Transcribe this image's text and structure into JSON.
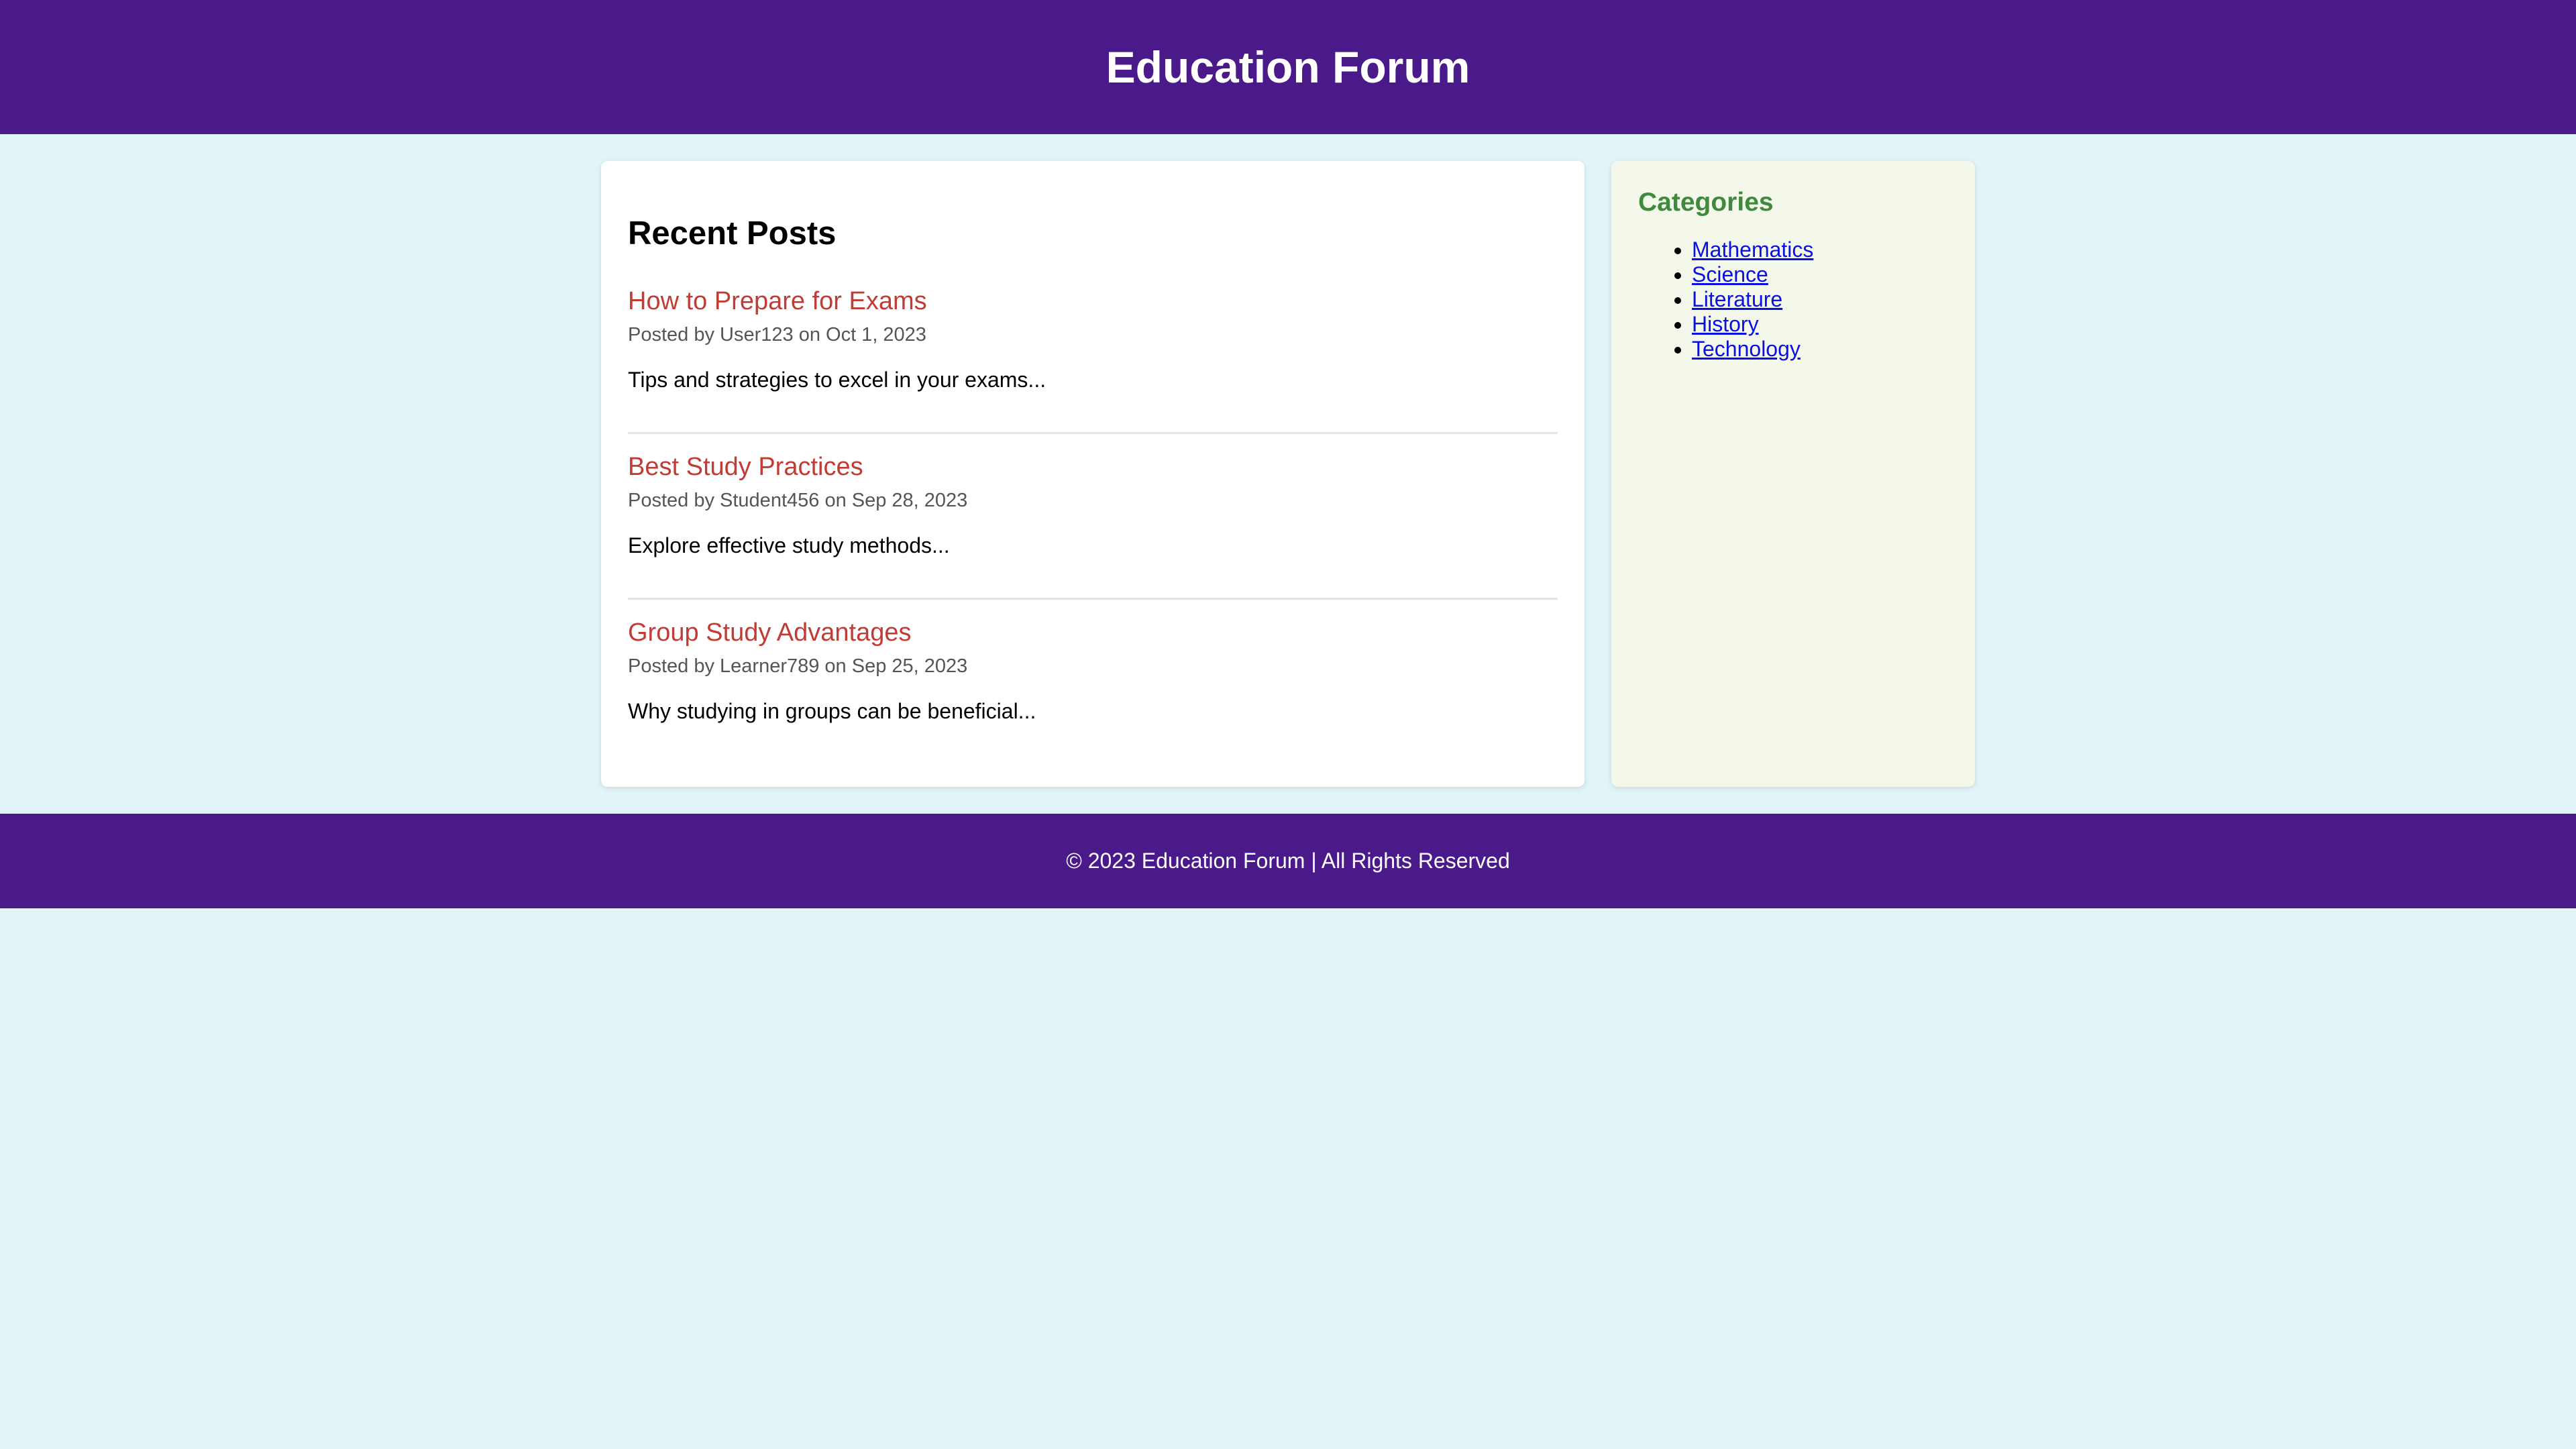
{
  "header": {
    "title": "Education Forum"
  },
  "main": {
    "heading": "Recent Posts",
    "posts": [
      {
        "title": "How to Prepare for Exams",
        "meta": "Posted by User123 on Oct 1, 2023",
        "excerpt": "Tips and strategies to excel in your exams..."
      },
      {
        "title": "Best Study Practices",
        "meta": "Posted by Student456 on Sep 28, 2023",
        "excerpt": "Explore effective study methods..."
      },
      {
        "title": "Group Study Advantages",
        "meta": "Posted by Learner789 on Sep 25, 2023",
        "excerpt": "Why studying in groups can be beneficial..."
      }
    ]
  },
  "sidebar": {
    "heading": "Categories",
    "categories": [
      "Mathematics",
      "Science",
      "Literature",
      "History",
      "Technology"
    ]
  },
  "footer": {
    "text": "© 2023 Education Forum | All Rights Reserved"
  },
  "colors": {
    "header_bg": "#4a1a8a",
    "page_bg": "#e1f5f9",
    "post_title": "#c23b35",
    "category_heading": "#3f8a3c",
    "link": "#0a10e0",
    "sidebar_bg": "#f3f8ea"
  }
}
